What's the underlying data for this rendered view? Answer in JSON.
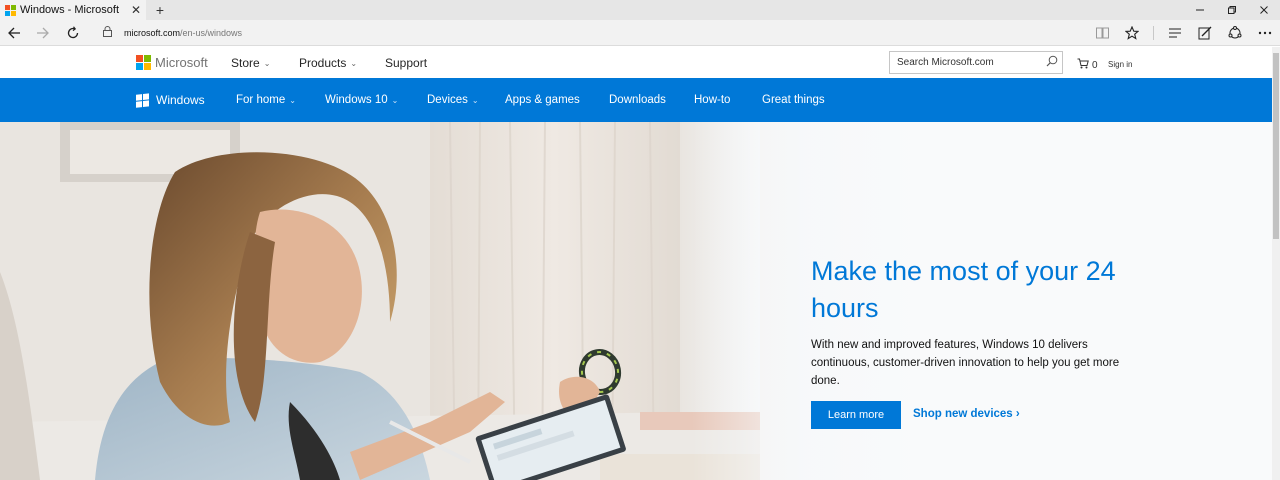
{
  "browser": {
    "tab_title": "Windows - Microsoft",
    "tab_close": "✕",
    "new_tab": "+",
    "url_host": "microsoft.com",
    "url_path": "/en-us/windows",
    "icons": [
      "back-icon",
      "forward-icon",
      "refresh-icon",
      "lock-icon",
      "reading-view-icon",
      "favorite-star-icon",
      "hub-icon",
      "web-note-icon",
      "share-icon",
      "more-icon"
    ]
  },
  "header": {
    "brand": "Microsoft",
    "nav": [
      {
        "label": "Store"
      },
      {
        "label": "Products"
      },
      {
        "label": "Support"
      }
    ],
    "search_placeholder": "Search Microsoft.com",
    "cart_count": "0",
    "sign_in": "Sign in"
  },
  "windows_bar": {
    "brand": "Windows",
    "items": [
      {
        "label": "For home"
      },
      {
        "label": "Windows 10"
      },
      {
        "label": "Devices"
      },
      {
        "label": "Apps & games"
      },
      {
        "label": "Downloads"
      },
      {
        "label": "How-to"
      },
      {
        "label": "Great things"
      }
    ]
  },
  "hero": {
    "heading": "Make the most of your 24 hours",
    "body": "With new and improved features, Windows 10 delivers continuous, customer-driven innovation to help you get more done.",
    "primary_button": "Learn more",
    "secondary_link": "Shop new devices ›"
  },
  "colors": {
    "accent": "#0078d7",
    "ms_red": "#f25022",
    "ms_green": "#7fba00",
    "ms_blue": "#00a4ef",
    "ms_yellow": "#ffb900"
  }
}
